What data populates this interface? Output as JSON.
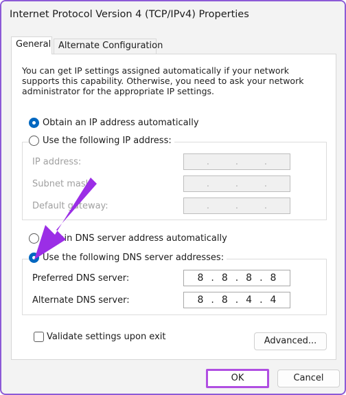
{
  "window": {
    "title": "Internet Protocol Version 4 (TCP/IPv4) Properties"
  },
  "tabs": [
    {
      "label": "General",
      "active": true
    },
    {
      "label": "Alternate Configuration",
      "active": false
    }
  ],
  "general": {
    "info_text": "You can get IP settings assigned automatically if your network supports this capability. Otherwise, you need to ask your network administrator for the appropriate IP settings.",
    "ip_auto_label": "Obtain an IP address automatically",
    "ip_manual_label": "Use the following IP address:",
    "ip_auto_selected": true,
    "ip_fields": {
      "ip_address_label": "IP address:",
      "subnet_mask_label": "Subnet mask:",
      "default_gateway_label": "Default gateway:"
    },
    "dns_auto_label": "Obtain DNS server address automatically",
    "dns_manual_label": "Use the following DNS server addresses:",
    "dns_manual_selected": true,
    "dns_fields": {
      "preferred_label": "Preferred DNS server:",
      "preferred_octets": [
        "8",
        "8",
        "8",
        "8"
      ],
      "alternate_label": "Alternate DNS server:",
      "alternate_octets": [
        "8",
        "8",
        "4",
        "4"
      ]
    },
    "validate_label": "Validate settings upon exit",
    "validate_checked": false,
    "advanced_label": "Advanced..."
  },
  "buttons": {
    "ok_label": "OK",
    "cancel_label": "Cancel"
  },
  "colors": {
    "accent": "#0067c0",
    "highlight": "#b04ee2",
    "annotation_arrow": "#9b2ee6"
  },
  "annotation": {
    "icon": "arrow-pointer-icon"
  }
}
